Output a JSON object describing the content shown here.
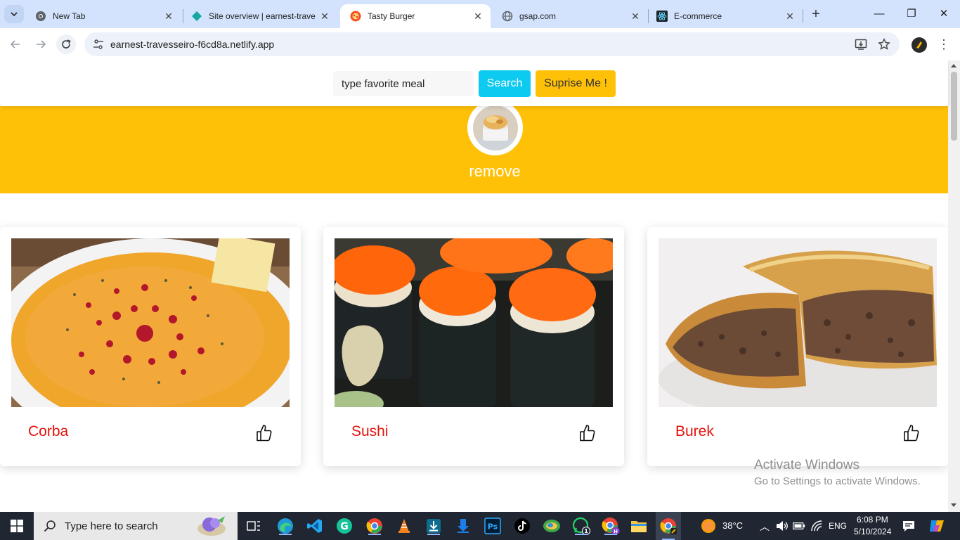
{
  "browser": {
    "tabs": [
      {
        "title": "New Tab",
        "icon": "chrome-icon",
        "active": false
      },
      {
        "title": "Site overview | earnest-trave",
        "icon": "netlify-icon",
        "active": false
      },
      {
        "title": "Tasty Burger",
        "icon": "burger-site-icon",
        "active": true
      },
      {
        "title": "gsap.com",
        "icon": "globe-icon",
        "active": false
      },
      {
        "title": "E-commerce",
        "icon": "react-icon",
        "active": false
      }
    ],
    "url": "earnest-travesseiro-f6cd8a.netlify.app"
  },
  "page": {
    "search": {
      "placeholder": "type favorite meal",
      "value": "type favorite meal"
    },
    "search_button": "Search",
    "surprise_button": "Suprise Me !",
    "hero": {
      "title": "remove"
    },
    "meals": [
      {
        "name": "Corba"
      },
      {
        "name": "Sushi"
      },
      {
        "name": "Burek"
      }
    ],
    "colors": {
      "accent": "#ffc107",
      "search_button": "#0dcaf0",
      "meal_name": "#e3120b"
    }
  },
  "watermark": {
    "line1": "Activate Windows",
    "line2": "Go to Settings to activate Windows."
  },
  "taskbar": {
    "search_placeholder": "Type here to search",
    "temperature": "38°C",
    "language": "ENG",
    "time": "6:08 PM",
    "date": "5/10/2024",
    "whatsapp_badge": "1"
  }
}
